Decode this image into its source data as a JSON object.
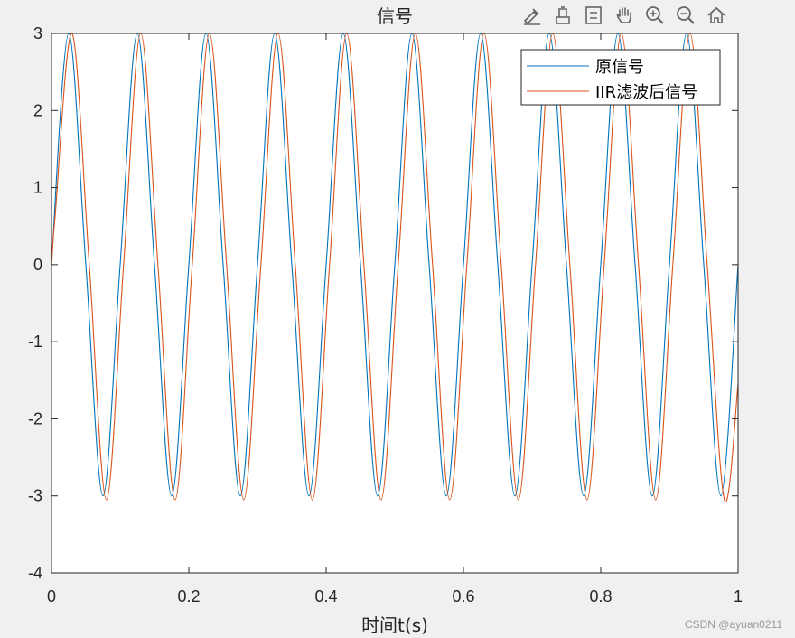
{
  "toolbar": {
    "buttons": [
      {
        "icon": "brush-icon"
      },
      {
        "icon": "data-tip-icon"
      },
      {
        "icon": "legend-toggle-icon"
      },
      {
        "icon": "pan-hand-icon"
      },
      {
        "icon": "zoom-in-icon"
      },
      {
        "icon": "zoom-out-icon"
      },
      {
        "icon": "home-icon"
      }
    ]
  },
  "watermark": "CSDN @ayuan0211",
  "chart_data": {
    "type": "line",
    "title": "信号",
    "xlabel": "时间t(s)",
    "ylabel": "",
    "xlim": [
      0,
      1
    ],
    "ylim": [
      -4,
      3
    ],
    "xticks": [
      0,
      0.2,
      0.4,
      0.6,
      0.8,
      1
    ],
    "xtick_labels": [
      "0",
      "0.2",
      "0.4",
      "0.6",
      "0.8",
      "1"
    ],
    "yticks": [
      -4,
      -3,
      -2,
      -1,
      0,
      1,
      2,
      3
    ],
    "ytick_labels": [
      "-4",
      "-3",
      "-2",
      "-1",
      "0",
      "1",
      "2",
      "3"
    ],
    "grid": false,
    "legend_position": "top-right",
    "series": [
      {
        "name": "原信号",
        "color": "#0072BD",
        "x": [
          0,
          0.025,
          0.05,
          0.075,
          0.1,
          0.125,
          0.15,
          0.175,
          0.2,
          0.225,
          0.25,
          0.275,
          0.3,
          0.325,
          0.35,
          0.375,
          0.4,
          0.425,
          0.45,
          0.475,
          0.5,
          0.525,
          0.55,
          0.575,
          0.6,
          0.625,
          0.65,
          0.675,
          0.7,
          0.725,
          0.75,
          0.775,
          0.8,
          0.825,
          0.85,
          0.875,
          0.9,
          0.925,
          0.95,
          0.975,
          1
        ],
        "y": [
          0,
          3,
          0,
          -3,
          0,
          3,
          0,
          -3,
          0,
          3,
          0,
          -3,
          0,
          3,
          0,
          -3,
          0,
          3,
          0,
          -3,
          0,
          3,
          0,
          -3,
          0,
          3,
          0,
          -3,
          0,
          3,
          0,
          -3,
          0,
          3,
          0,
          -3,
          0,
          3,
          0,
          -3,
          0
        ]
      },
      {
        "name": "IIR滤波后信号",
        "color": "#D95319",
        "x": [
          0,
          0.005,
          0.03,
          0.055,
          0.08,
          0.105,
          0.13,
          0.155,
          0.18,
          0.205,
          0.23,
          0.255,
          0.28,
          0.305,
          0.33,
          0.355,
          0.38,
          0.405,
          0.43,
          0.455,
          0.48,
          0.505,
          0.53,
          0.555,
          0.58,
          0.605,
          0.63,
          0.655,
          0.68,
          0.705,
          0.73,
          0.755,
          0.78,
          0.805,
          0.83,
          0.855,
          0.88,
          0.905,
          0.93,
          0.955,
          0.98,
          1
        ],
        "y": [
          0,
          0.6,
          3,
          0,
          -3.05,
          0,
          3,
          0,
          -3.05,
          0,
          3,
          0,
          -3.05,
          0,
          3,
          0,
          -3.05,
          0,
          3,
          0,
          -3.05,
          0,
          3,
          0,
          -3.05,
          0,
          3,
          0,
          -3.05,
          0,
          3,
          0,
          -3.05,
          0,
          3,
          0,
          -3.05,
          0,
          3,
          0,
          -3.05,
          -1.55
        ]
      }
    ]
  }
}
